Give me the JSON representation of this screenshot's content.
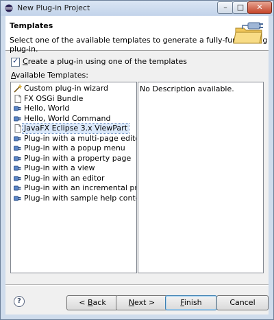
{
  "window": {
    "title": "New Plug-in Project",
    "minimize": "–",
    "maximize": "□",
    "close": "✕"
  },
  "header": {
    "title": "Templates",
    "description": "Select one of the available templates to generate a fully-functioning plug-in."
  },
  "create_checkbox": {
    "label": "Create a plug-in using one of the templates",
    "checked": true
  },
  "available_label": "Available Templates:",
  "templates": [
    {
      "label": "Custom plug-in wizard",
      "icon": "wand-icon",
      "selected": false
    },
    {
      "label": "FX OSGi Bundle",
      "icon": "document-icon",
      "selected": false
    },
    {
      "label": "Hello, World",
      "icon": "plugin-icon",
      "selected": false
    },
    {
      "label": "Hello, World Command",
      "icon": "plugin-icon",
      "selected": false
    },
    {
      "label": "JavaFX Eclipse 3.x ViewPart",
      "icon": "document-icon",
      "selected": true
    },
    {
      "label": "Plug-in with a multi-page editor",
      "icon": "plugin-icon",
      "selected": false
    },
    {
      "label": "Plug-in with a popup menu",
      "icon": "plugin-icon",
      "selected": false
    },
    {
      "label": "Plug-in with a property page",
      "icon": "plugin-icon",
      "selected": false
    },
    {
      "label": "Plug-in with a view",
      "icon": "plugin-icon",
      "selected": false
    },
    {
      "label": "Plug-in with an editor",
      "icon": "plugin-icon",
      "selected": false
    },
    {
      "label": "Plug-in with an incremental project builder",
      "icon": "plugin-icon",
      "selected": false
    },
    {
      "label": "Plug-in with sample help content",
      "icon": "plugin-icon",
      "selected": false
    }
  ],
  "description_panel": "No Description available.",
  "buttons": {
    "help": "?",
    "back": {
      "mnemonic": "B",
      "rest": "ack",
      "prefix": "< "
    },
    "next": {
      "mnemonic": "N",
      "rest": "ext >"
    },
    "finish": {
      "mnemonic": "F",
      "rest": "inish"
    },
    "cancel": "Cancel"
  }
}
